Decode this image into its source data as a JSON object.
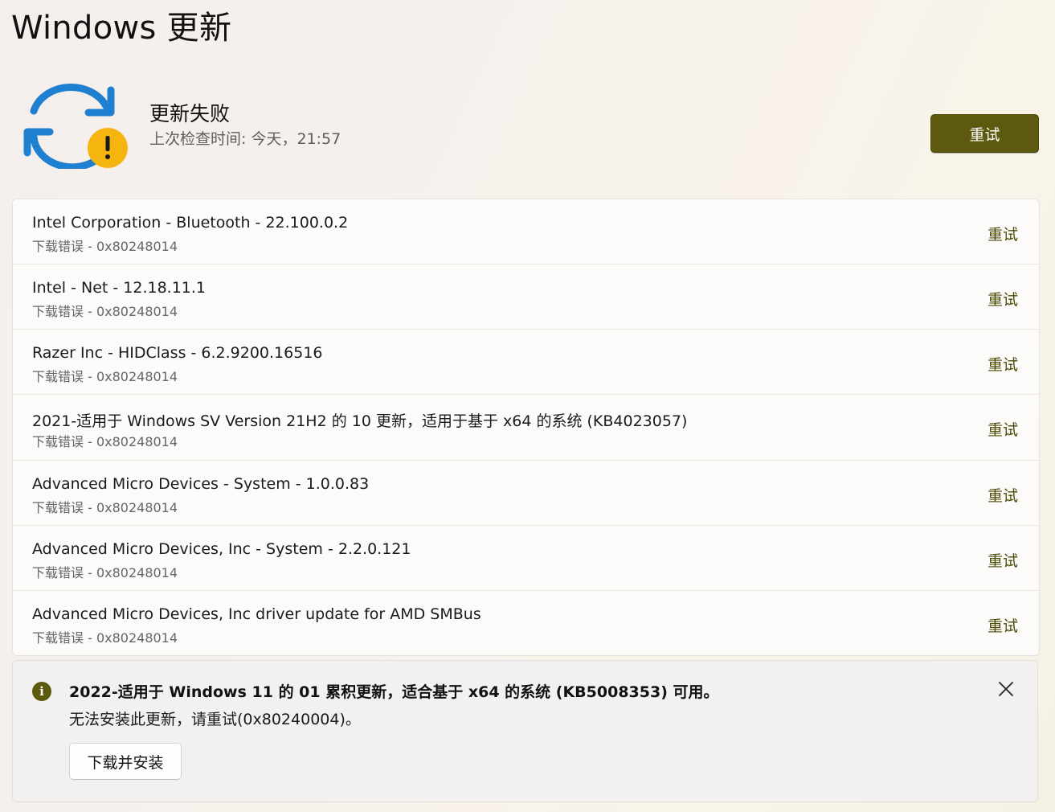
{
  "page": {
    "title": "Windows 更新"
  },
  "status": {
    "title": "更新失败",
    "last_checked": "上次检查时间: 今天，21:57",
    "retry_label": "重试",
    "icon": "sync-warning-icon"
  },
  "updates": [
    {
      "name": "Intel Corporation - Bluetooth - 22.100.0.2",
      "error": "下载错误 - 0x80248014",
      "action": "重试"
    },
    {
      "name": "Intel - Net - 12.18.11.1",
      "error": "下载错误 - 0x80248014",
      "action": "重试"
    },
    {
      "name": "Razer Inc - HIDClass - 6.2.9200.16516",
      "error": "下载错误 - 0x80248014",
      "action": "重试"
    },
    {
      "name": "2021-适用于 Windows SV Version 21H2 的 10 更新，适用于基于 x64 的系统 (KB4023057)",
      "error": "下载错误 - 0x80248014",
      "action": "重试"
    },
    {
      "name": "Advanced Micro Devices - System - 1.0.0.83",
      "error": "下载错误 - 0x80248014",
      "action": "重试"
    },
    {
      "name": "Advanced Micro Devices, Inc - System - 2.2.0.121",
      "error": "下载错误 - 0x80248014",
      "action": "重试"
    },
    {
      "name": "Advanced Micro Devices, Inc driver update for AMD SMBus",
      "error": "下载错误 - 0x80248014",
      "action": "重试"
    }
  ],
  "info_bar": {
    "icon": "info-icon",
    "title": "2022-适用于 Windows 11 的 01 累积更新，适合基于 x64 的系统 (KB5008353) 可用。",
    "message": "无法安装此更新，请重试(0x80240004)。",
    "action_label": "下载并安装",
    "close_icon": "close-icon"
  },
  "colors": {
    "accent": "#5d5a0f",
    "accent_text": "#4e4b06",
    "sync_arrow": "#1f7fd1",
    "warning": "#f6b40e"
  }
}
